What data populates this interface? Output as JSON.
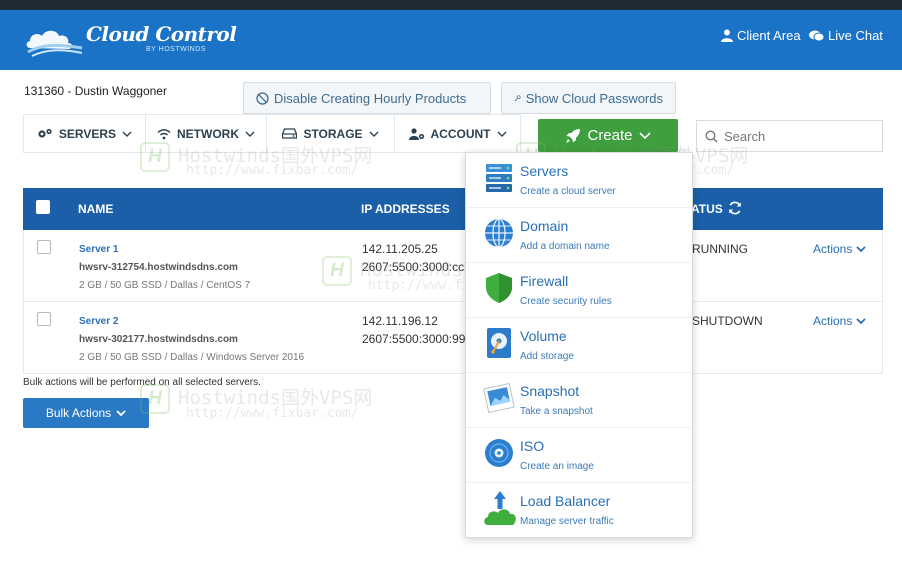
{
  "header": {
    "logo_text": "Cloud Control",
    "logo_sub": "BY HOSTWINDS",
    "client_area": "Client Area",
    "live_chat": "Live Chat"
  },
  "account": {
    "id_name": "131360 - Dustin Waggoner"
  },
  "buttons": {
    "disable_hourly": "Disable Creating Hourly Products",
    "show_passwords": "Show Cloud Passwords",
    "create": "Create",
    "bulk_actions": "Bulk Actions"
  },
  "nav": [
    {
      "label": "SERVERS"
    },
    {
      "label": "NETWORK"
    },
    {
      "label": "STORAGE"
    },
    {
      "label": "ACCOUNT"
    }
  ],
  "search": {
    "placeholder": "Search"
  },
  "table": {
    "headers": {
      "name": "NAME",
      "ip": "IP ADDRESSES",
      "status": "ATUS"
    },
    "rows": [
      {
        "name": "Server 1",
        "host": "hwsrv-312754.hostwindsdns.com",
        "spec": "2 GB / 50 GB SSD / Dallas / CentOS 7",
        "ipv4": "142.11.205.25",
        "ipv6": "2607:5500:3000:cc",
        "status": "RUNNING",
        "actions": "Actions"
      },
      {
        "name": "Server 2",
        "host": "hwsrv-302177.hostwindsdns.com",
        "spec": "2 GB / 50 GB SSD / Dallas / Windows Server 2016",
        "ipv4": "142.11.196.12",
        "ipv6": "2607:5500:3000:99",
        "status": "SHUTDOWN",
        "actions": "Actions"
      }
    ]
  },
  "bulk_note": "Bulk actions will be performed on all selected servers.",
  "create_menu": [
    {
      "title": "Servers",
      "subtitle": "Create a cloud server",
      "icon": "servers-icon"
    },
    {
      "title": "Domain",
      "subtitle": "Add a domain name",
      "icon": "globe-icon"
    },
    {
      "title": "Firewall",
      "subtitle": "Create security rules",
      "icon": "shield-icon"
    },
    {
      "title": "Volume",
      "subtitle": "Add storage",
      "icon": "volume-icon"
    },
    {
      "title": "Snapshot",
      "subtitle": "Take a snapshot",
      "icon": "snapshot-icon"
    },
    {
      "title": "ISO",
      "subtitle": "Create an image",
      "icon": "disc-icon"
    },
    {
      "title": "Load Balancer",
      "subtitle": "Manage server traffic",
      "icon": "load-balancer-icon"
    }
  ],
  "watermark": {
    "line1": "Hostwinds国外VPS网",
    "line2": "http://www.fixbar.com/",
    "logo": "H"
  },
  "colors": {
    "header_blue": "#1a73c6",
    "table_head_blue": "#1a5fa8",
    "create_green": "#3f9f3f",
    "link_blue": "#2a6fb5"
  }
}
